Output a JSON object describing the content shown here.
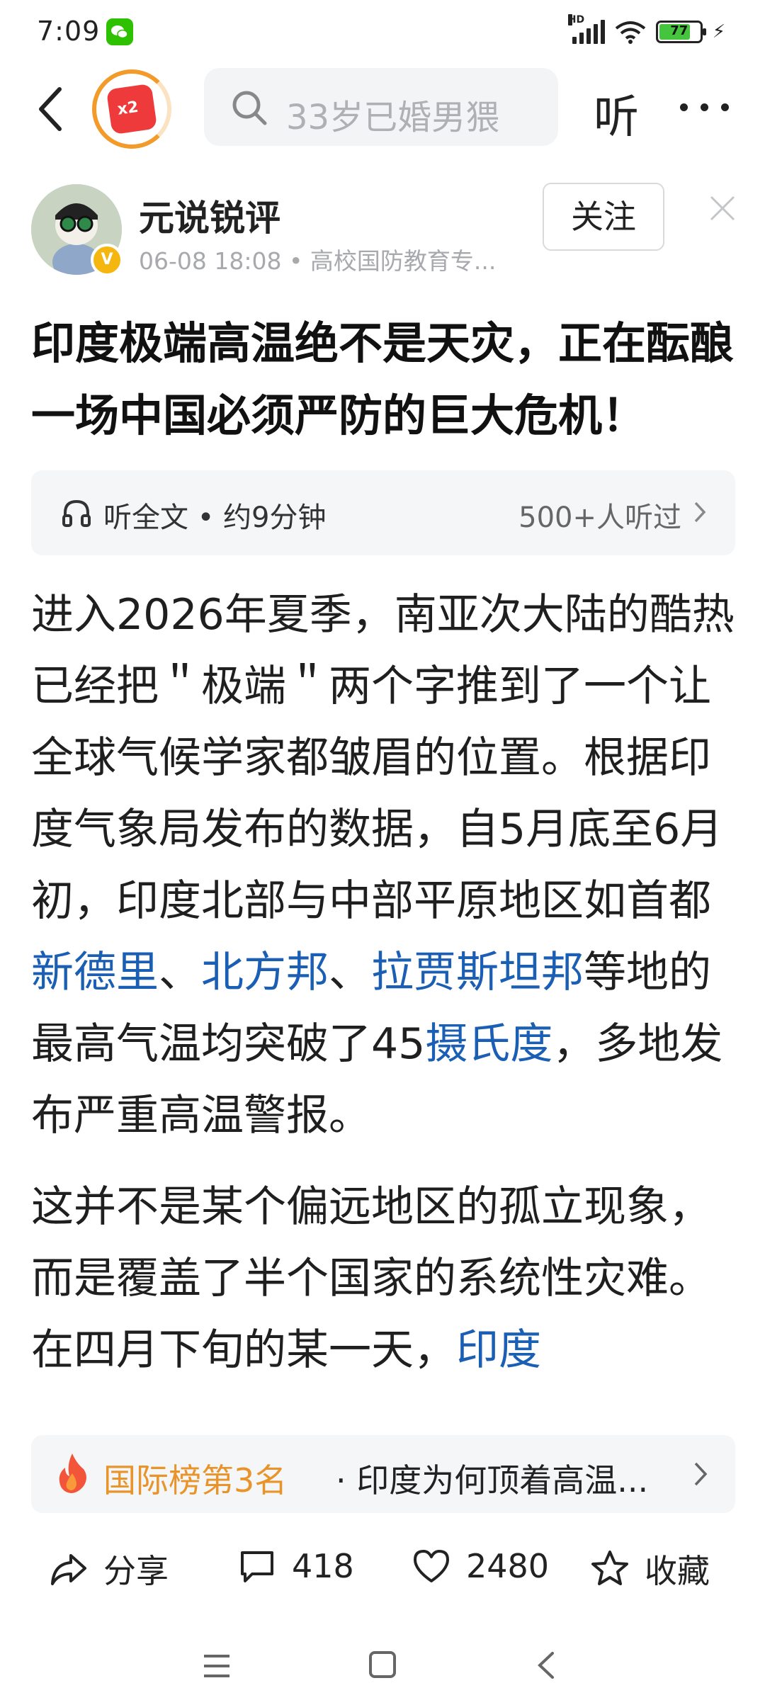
{
  "status_bar": {
    "time": "7:09",
    "network": "HD",
    "battery_level": "77",
    "battery_fraction": 0.77,
    "icons": [
      "wechat-icon",
      "signal-icon",
      "wifi-icon",
      "battery-icon",
      "charging-icon"
    ]
  },
  "header": {
    "redpacket_badge": "x2",
    "search_placeholder": "33岁已婚男猥",
    "listen_label": "听",
    "icons": [
      "back-icon",
      "redpacket-icon",
      "search-icon",
      "more-icon"
    ]
  },
  "author": {
    "name": "元说锐评",
    "meta": "06-08 18:08 • 高校国防教育专...",
    "verified_badge": "V",
    "follow_label": "关注"
  },
  "article": {
    "title": "印度极端高温绝不是天灾，正在酝酿一场中国必须严防的巨大危机！",
    "listen_bar": {
      "label": "听全文 • 约9分钟",
      "count": "500+人听过"
    },
    "paragraph1": {
      "part1": "进入2026年夏季，南亚次大陆的酷热已经把＂极端＂两个字推到了一个让全球气候学家都皱眉的位置。根据印度气象局发布的数据，自5月底至6月初，印度北部与中部平原地区如首都",
      "link1": "新德里",
      "part2": "、",
      "link2": "北方邦",
      "part3": "、",
      "link3": "拉贾斯坦邦",
      "part4": "等地的最高气温均突破了45",
      "link4": "摄氏度",
      "part5": "，多地发布严重高温警报。"
    },
    "paragraph2": {
      "part1": "这并不是某个偏远地区的孤立现象，而是覆盖了半个国家的系统性灾难。在四月下旬的某一天，",
      "link1": "印度"
    }
  },
  "rank_bar": {
    "label": "国际榜第3名",
    "text": "· 印度为何顶着高温..."
  },
  "actions": {
    "share_label": "分享",
    "comment_count": "418",
    "like_count": "2480",
    "favorite_label": "收藏"
  },
  "colors": {
    "link": "#1a5fb4",
    "rank_orange": "#e9942a",
    "accent_red": "#ee3a3a",
    "panel_bg": "#f5f6f8"
  }
}
